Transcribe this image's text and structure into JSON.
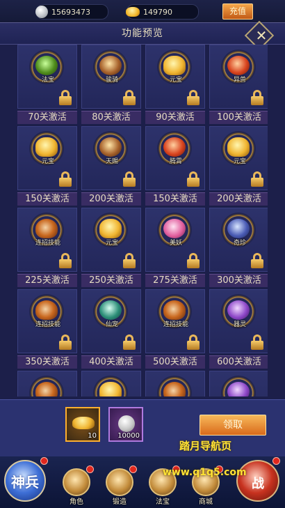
{
  "currency": {
    "silver": "15693473",
    "gold": "149790",
    "recharge_label": "充值"
  },
  "panel": {
    "title": "功能预览"
  },
  "features": [
    {
      "name": "法宝",
      "unlock": "70关激活",
      "icon": "ic-gold"
    },
    {
      "name": "骏骑",
      "unlock": "80关激活",
      "icon": "ic-wine"
    },
    {
      "name": "元宝",
      "unlock": "90关激活",
      "icon": "ic-treasure"
    },
    {
      "name": "异兽",
      "unlock": "100关激活",
      "icon": "ic-red"
    },
    {
      "name": "元宝",
      "unlock": "150关激活",
      "icon": "ic-treasure"
    },
    {
      "name": "天赐",
      "unlock": "200关激活",
      "icon": "ic-wine"
    },
    {
      "name": "腾霄",
      "unlock": "150关激活",
      "icon": "ic-red"
    },
    {
      "name": "元宝",
      "unlock": "200关激活",
      "icon": "ic-treasure"
    },
    {
      "name": "连招技能",
      "unlock": "225关激活",
      "icon": "ic-bow"
    },
    {
      "name": "元宝",
      "unlock": "250关激活",
      "icon": "ic-treasure"
    },
    {
      "name": "美妖",
      "unlock": "275关激活",
      "icon": "ic-pink"
    },
    {
      "name": "奇珍",
      "unlock": "300关激活",
      "icon": "ic-blue"
    },
    {
      "name": "连招技能",
      "unlock": "350关激活",
      "icon": "ic-bow"
    },
    {
      "name": "仙宠",
      "unlock": "400关激活",
      "icon": "ic-green"
    },
    {
      "name": "连招技能",
      "unlock": "500关激活",
      "icon": "ic-bow"
    },
    {
      "name": "器灵",
      "unlock": "600关激活",
      "icon": "ic-purple"
    },
    {
      "name": "",
      "unlock": "",
      "icon": "ic-bow"
    },
    {
      "name": "",
      "unlock": "",
      "icon": "ic-treasure"
    },
    {
      "name": "",
      "unlock": "",
      "icon": "ic-bow"
    },
    {
      "name": "",
      "unlock": "",
      "icon": "ic-purple"
    }
  ],
  "rewards": [
    {
      "name": "gold-ingot",
      "qty": "10"
    },
    {
      "name": "silver-coins",
      "qty": "10000"
    }
  ],
  "claim_label": "领取",
  "watermark": {
    "title": "踏月导航页",
    "url": "www.q1q5.com"
  },
  "nav": {
    "god_label": "神兵",
    "role": "角色",
    "forge": "锻造",
    "treasure": "法宝",
    "shop": "商城",
    "right_label": "战"
  }
}
